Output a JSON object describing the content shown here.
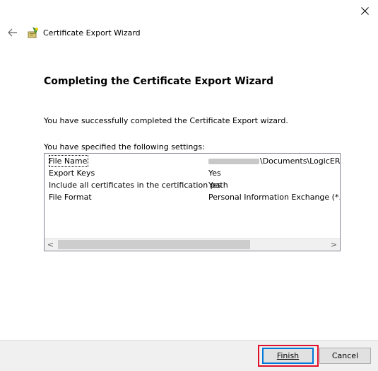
{
  "window": {
    "title": "Certificate Export Wizard",
    "close_label": "×"
  },
  "page": {
    "heading": "Completing the Certificate Export Wizard",
    "success_message": "You have successfully completed the Certificate Export wizard.",
    "settings_label": "You have specified the following settings:"
  },
  "settings": [
    {
      "name": "File Name",
      "value": "\\Documents\\LogicERPDe",
      "redacted_prefix": true
    },
    {
      "name": "Export Keys",
      "value": "Yes"
    },
    {
      "name": "Include all certificates in the certification path",
      "value": "Yes"
    },
    {
      "name": "File Format",
      "value": "Personal Information Exchange (*.pfx)"
    }
  ],
  "scrollbar": {
    "left_arrow": "<",
    "right_arrow": ">"
  },
  "buttons": {
    "finish": "Finish",
    "cancel": "Cancel"
  },
  "colors": {
    "highlight": "#e0102a",
    "focus": "#0078d7"
  }
}
